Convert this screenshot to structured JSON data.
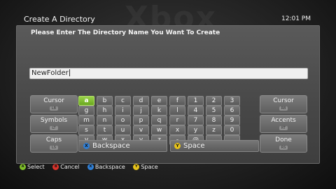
{
  "header": {
    "title": "Create A Directory",
    "clock": "12:01 PM",
    "bg_word": "Xbox"
  },
  "dialog": {
    "prompt": "Please Enter The Directory Name You Want To Create",
    "input_value": "NewFolder"
  },
  "side_buttons": {
    "left": [
      {
        "label": "Cursor",
        "sub": "LB"
      },
      {
        "label": "Symbols",
        "sub": "LT"
      },
      {
        "label": "Caps",
        "sub": "LS"
      }
    ],
    "right": [
      {
        "label": "Cursor",
        "sub": "RB"
      },
      {
        "label": "Accents",
        "sub": "RT"
      },
      {
        "label": "Done",
        "sub": "RS"
      }
    ]
  },
  "keyboard": {
    "rows": [
      [
        "a",
        "b",
        "c",
        "d",
        "e",
        "f",
        "1",
        "2",
        "3"
      ],
      [
        "g",
        "h",
        "i",
        "j",
        "k",
        "l",
        "4",
        "5",
        "6"
      ],
      [
        "m",
        "n",
        "o",
        "p",
        "q",
        "r",
        "7",
        "8",
        "9"
      ],
      [
        "s",
        "t",
        "u",
        "v",
        "w",
        "x",
        "y",
        "z",
        "0"
      ],
      [
        "v",
        "w",
        "x",
        "y",
        "z",
        "-",
        "@",
        "_",
        "."
      ]
    ],
    "selected": "a",
    "backspace_label": "Backspace",
    "space_label": "Space"
  },
  "footer": {
    "items": [
      {
        "button": "A",
        "label": "Select",
        "color": "#7fbf2a"
      },
      {
        "button": "B",
        "label": "Cancel",
        "color": "#d9332b"
      },
      {
        "button": "X",
        "label": "Backspace",
        "color": "#2f7fd6"
      },
      {
        "button": "Y",
        "label": "Space",
        "color": "#e6c21a"
      }
    ]
  }
}
